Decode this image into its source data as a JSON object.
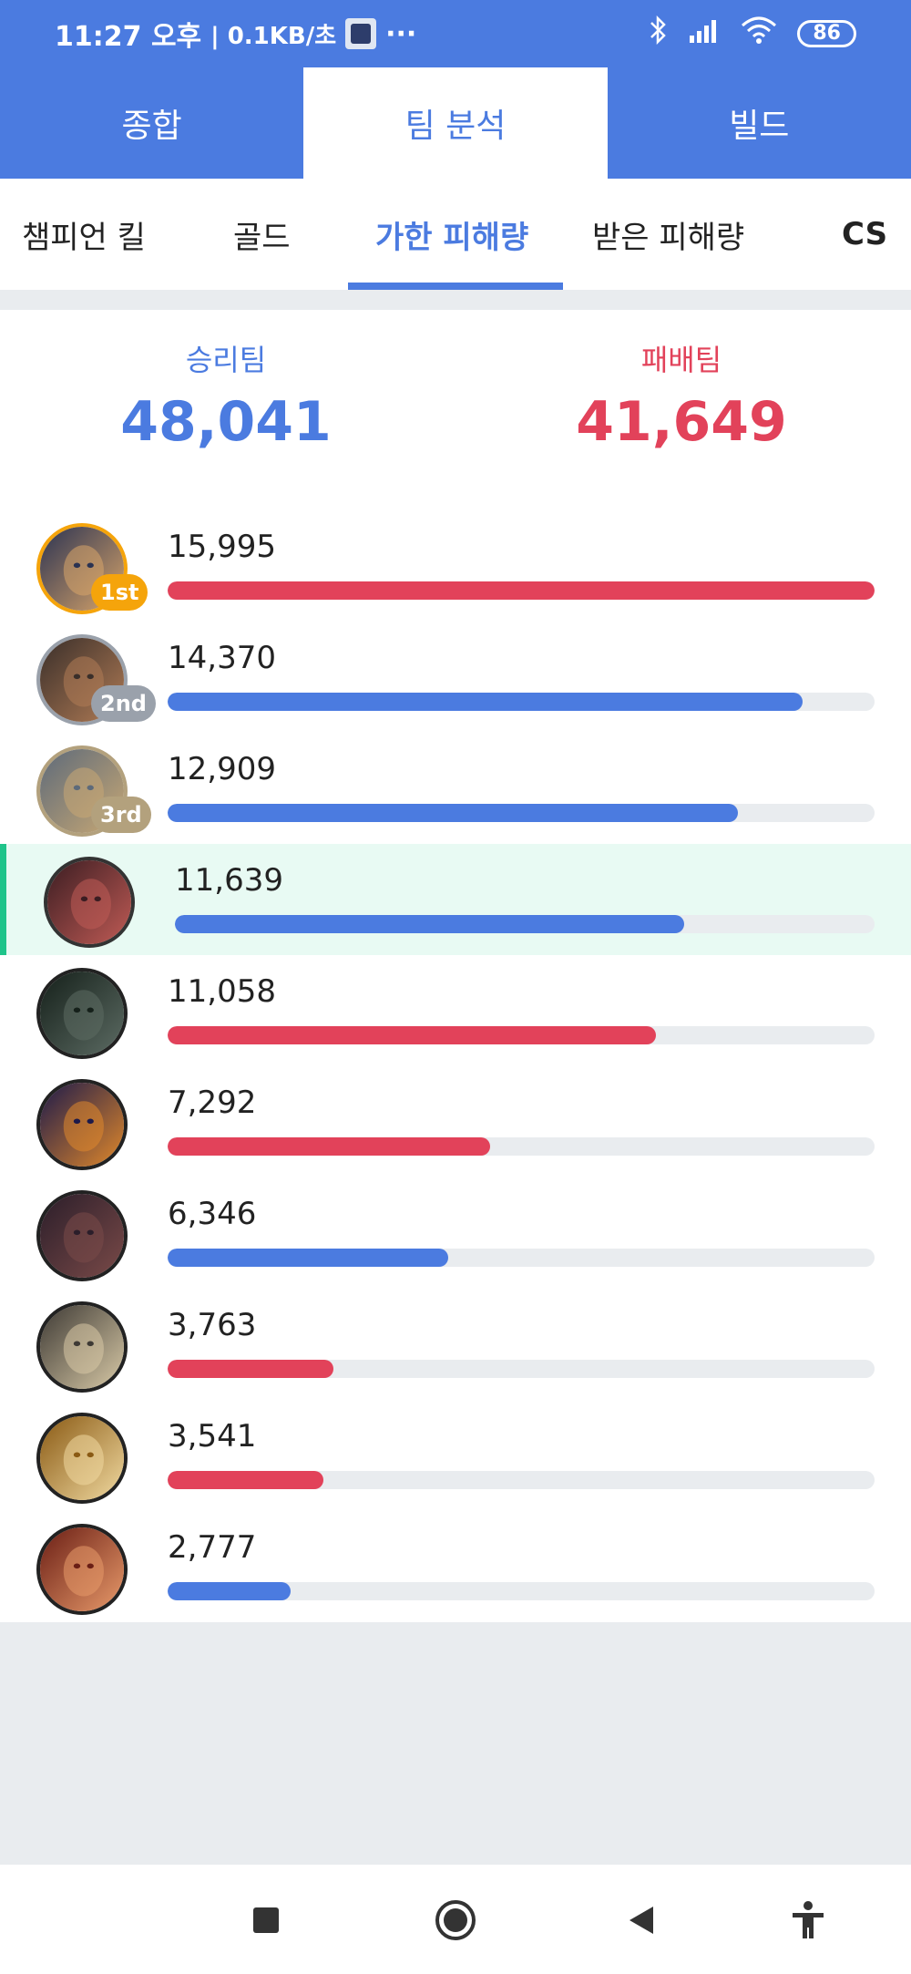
{
  "status": {
    "time": "11:27 오후",
    "speed": "| 0.1KB/초",
    "more": "···",
    "battery": "86"
  },
  "top_tabs": [
    {
      "label": "종합"
    },
    {
      "label": "팀 분석"
    },
    {
      "label": "빌드"
    }
  ],
  "sub_tabs": [
    {
      "label": "챔피언 킬"
    },
    {
      "label": "골드"
    },
    {
      "label": "가한 피해량"
    },
    {
      "label": "받은 피해량"
    },
    {
      "label": "CS"
    }
  ],
  "summary": {
    "win_label": "승리팀",
    "win_value": "48,041",
    "lose_label": "패배팀",
    "lose_value": "41,649"
  },
  "players": [
    {
      "value": "15,995",
      "team": "lose",
      "rank": "1st",
      "percent": 100,
      "avatar_colors": [
        "#2b3352",
        "#d9a56a"
      ],
      "ring": "#f5a40b"
    },
    {
      "value": "14,370",
      "team": "win",
      "rank": "2nd",
      "percent": 89.8,
      "avatar_colors": [
        "#3a2f2a",
        "#b07b55"
      ],
      "ring": "#9aa1ab"
    },
    {
      "value": "12,909",
      "team": "win",
      "rank": "3rd",
      "percent": 80.7,
      "avatar_colors": [
        "#5d6a7a",
        "#c8a874"
      ],
      "ring": "#b3a17d"
    },
    {
      "value": "11,639",
      "team": "win",
      "rank": "",
      "percent": 72.8,
      "avatar_colors": [
        "#3b1d22",
        "#c05b55"
      ],
      "ring": "#333"
    },
    {
      "value": "11,058",
      "team": "lose",
      "rank": "",
      "percent": 69.1,
      "avatar_colors": [
        "#15201a",
        "#5c6b63"
      ],
      "ring": "#222"
    },
    {
      "value": "7,292",
      "team": "lose",
      "rank": "",
      "percent": 45.6,
      "avatar_colors": [
        "#1d1a4a",
        "#e0882b"
      ],
      "ring": "#222"
    },
    {
      "value": "6,346",
      "team": "win",
      "rank": "",
      "percent": 39.7,
      "avatar_colors": [
        "#2b1e2a",
        "#7a4a48"
      ],
      "ring": "#222"
    },
    {
      "value": "3,763",
      "team": "lose",
      "rank": "",
      "percent": 23.5,
      "avatar_colors": [
        "#3e3a35",
        "#d8c9a6"
      ],
      "ring": "#222"
    },
    {
      "value": "3,541",
      "team": "lose",
      "rank": "",
      "percent": 22.1,
      "avatar_colors": [
        "#8a5a14",
        "#f0d9a0"
      ],
      "ring": "#222"
    },
    {
      "value": "2,777",
      "team": "win",
      "rank": "",
      "percent": 17.4,
      "avatar_colors": [
        "#6a1e15",
        "#e89a6a"
      ],
      "ring": "#222"
    }
  ],
  "colors": {
    "win": "#4b7be0",
    "lose": "#e2425a",
    "highlight": "#e8faf3"
  },
  "icons": {
    "status": [
      "bluetooth-icon",
      "signal-icon",
      "wifi-icon",
      "battery-icon"
    ],
    "nav": [
      "recent-apps-icon",
      "home-icon",
      "back-icon",
      "accessibility-icon"
    ]
  }
}
